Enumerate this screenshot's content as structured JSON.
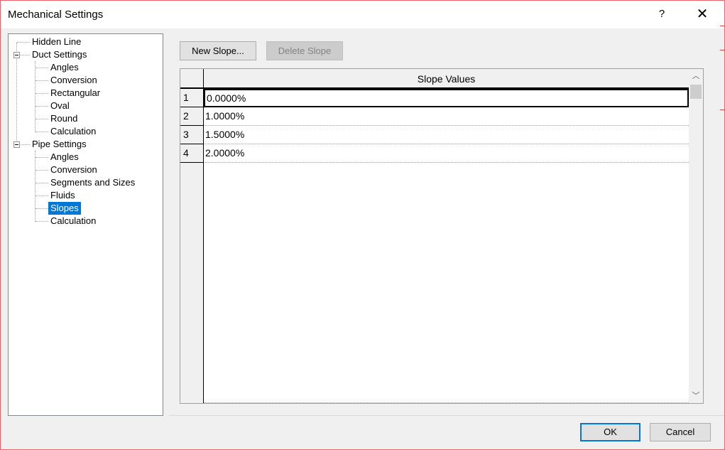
{
  "window": {
    "title": "Mechanical Settings",
    "help_glyph": "?",
    "close_glyph": "✕"
  },
  "tree": {
    "items": [
      {
        "label": "Hidden Line"
      },
      {
        "label": "Duct Settings"
      },
      {
        "label": "Angles"
      },
      {
        "label": "Conversion"
      },
      {
        "label": "Rectangular"
      },
      {
        "label": "Oval"
      },
      {
        "label": "Round"
      },
      {
        "label": "Calculation"
      },
      {
        "label": "Pipe Settings"
      },
      {
        "label": "Angles"
      },
      {
        "label": "Conversion"
      },
      {
        "label": "Segments and Sizes"
      },
      {
        "label": "Fluids"
      },
      {
        "label": "Slopes"
      },
      {
        "label": "Calculation"
      }
    ],
    "selected": "Slopes"
  },
  "toolbar": {
    "new_slope_label": "New Slope...",
    "delete_slope_label": "Delete Slope"
  },
  "grid": {
    "column_header": "Slope Values",
    "rows": [
      {
        "index": "1",
        "value": "0.0000%"
      },
      {
        "index": "2",
        "value": "1.0000%"
      },
      {
        "index": "3",
        "value": "1.5000%"
      },
      {
        "index": "4",
        "value": "2.0000%"
      }
    ],
    "scroll_up_glyph": "︿",
    "scroll_down_glyph": "﹀"
  },
  "footer": {
    "ok_label": "OK",
    "cancel_label": "Cancel"
  },
  "colors": {
    "selection": "#0078d7",
    "window_border": "#e8636a"
  }
}
